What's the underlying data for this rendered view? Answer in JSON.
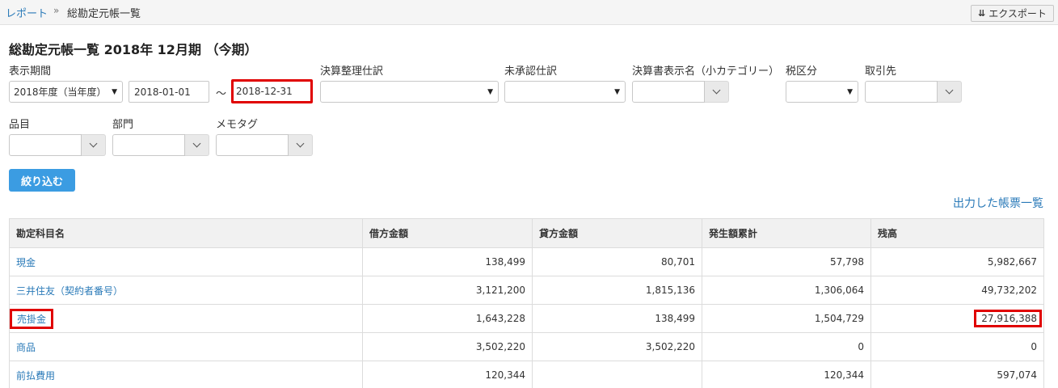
{
  "breadcrumb": {
    "link": "レポート",
    "separator": "»",
    "current": "総勘定元帳一覧"
  },
  "export_label": "エクスポート",
  "page_title": "総勘定元帳一覧 2018年 12月期 （今期）",
  "filters": {
    "period": {
      "label": "表示期間",
      "selected": "2018年度（当年度）",
      "start": "2018-01-01",
      "tilde": "～",
      "end": "2018-12-31"
    },
    "closing_entries": {
      "label": "決算整理仕訳",
      "selected": ""
    },
    "unapproved": {
      "label": "未承認仕訳",
      "selected": ""
    },
    "statement_name": {
      "label": "決算書表示名（小カテゴリー）"
    },
    "tax_class": {
      "label": "税区分",
      "selected": ""
    },
    "partner": {
      "label": "取引先"
    },
    "item": {
      "label": "品目"
    },
    "department": {
      "label": "部門"
    },
    "memo_tag": {
      "label": "メモタグ"
    }
  },
  "filter_button": "絞り込む",
  "output_link": "出力した帳票一覧",
  "table": {
    "headers": [
      "勘定科目名",
      "借方金額",
      "貸方金額",
      "発生額累計",
      "残高"
    ],
    "rows": [
      {
        "name": "現金",
        "debit": "138,499",
        "credit": "80,701",
        "cumulative": "57,798",
        "balance": "5,982,667"
      },
      {
        "name": "三井住友（契約者番号）",
        "debit": "3,121,200",
        "credit": "1,815,136",
        "cumulative": "1,306,064",
        "balance": "49,732,202"
      },
      {
        "name": "売掛金",
        "debit": "1,643,228",
        "credit": "138,499",
        "cumulative": "1,504,729",
        "balance": "27,916,388"
      },
      {
        "name": "商品",
        "debit": "3,502,220",
        "credit": "3,502,220",
        "cumulative": "0",
        "balance": "0"
      },
      {
        "name": "前払費用",
        "debit": "120,344",
        "credit": "",
        "cumulative": "120,344",
        "balance": "597,074"
      }
    ]
  },
  "colors": {
    "link": "#2a7ab8",
    "primary_button": "#3b9ce2",
    "highlight": "#e00000"
  }
}
